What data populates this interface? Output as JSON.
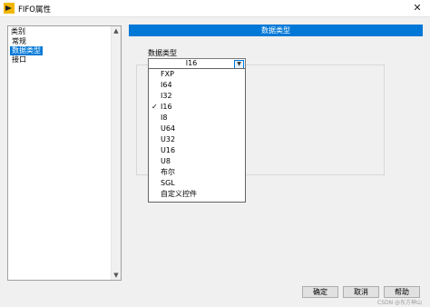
{
  "window": {
    "title": "FIFO属性",
    "close_glyph": "✕"
  },
  "category_list": {
    "header": "类别",
    "items": [
      {
        "label": "常规",
        "selected": false
      },
      {
        "label": "数据类型",
        "selected": true
      },
      {
        "label": "接口",
        "selected": false
      }
    ]
  },
  "section": {
    "title": "数据类型"
  },
  "data_type": {
    "label": "数据类型",
    "value": "I16",
    "options": [
      {
        "label": "FXP",
        "checked": false
      },
      {
        "label": "I64",
        "checked": false
      },
      {
        "label": "I32",
        "checked": false
      },
      {
        "label": "I16",
        "checked": true
      },
      {
        "label": "I8",
        "checked": false
      },
      {
        "label": "U64",
        "checked": false
      },
      {
        "label": "U32",
        "checked": false
      },
      {
        "label": "U16",
        "checked": false
      },
      {
        "label": "U8",
        "checked": false
      },
      {
        "label": "布尔",
        "checked": false
      },
      {
        "label": "SGL",
        "checked": false
      },
      {
        "label": "自定义控件",
        "checked": false
      }
    ],
    "check_glyph": "✓"
  },
  "footer": {
    "ok_label": "确定",
    "cancel_label": "取消",
    "help_label": "帮助"
  },
  "watermark": "CSDN @东方神山",
  "colors": {
    "accent": "#0078d7",
    "app_icon": "#f2b705"
  }
}
